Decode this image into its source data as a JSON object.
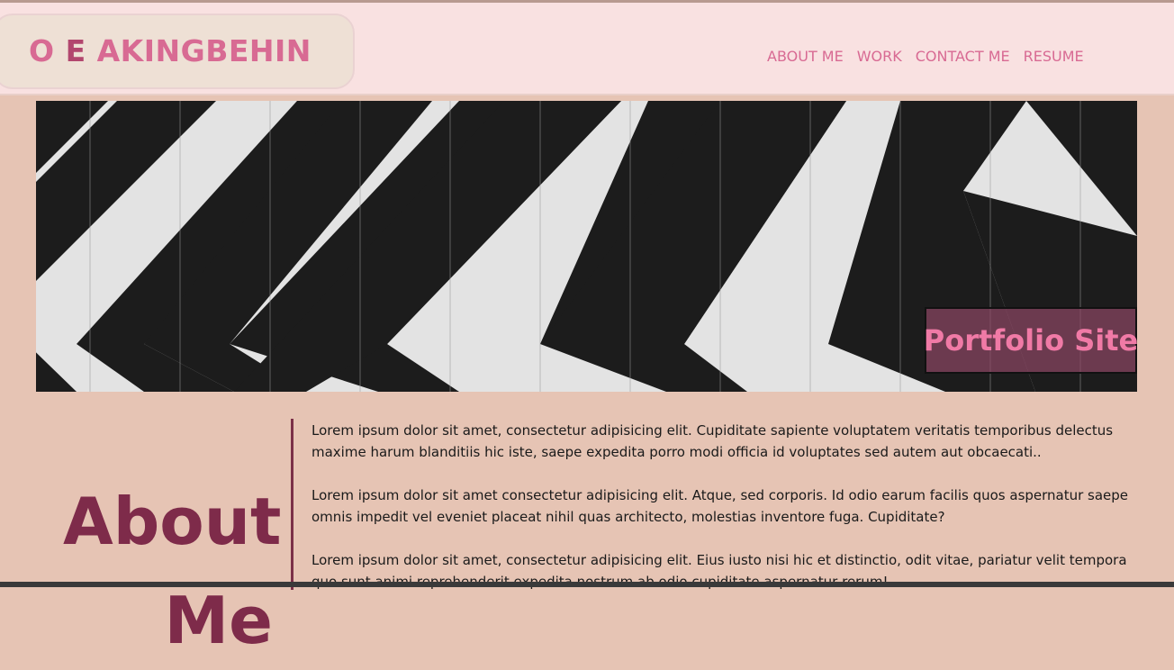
{
  "header": {
    "brand": {
      "part1": "O",
      "part2": "E",
      "part3": "AKINGBEHIN"
    },
    "nav": [
      {
        "label": "ABOUT ME"
      },
      {
        "label": "WORK"
      },
      {
        "label": "CONTACT ME"
      },
      {
        "label": "RESUME"
      }
    ]
  },
  "hero": {
    "image": "black-and-white-striped-wood-image",
    "caption": "Portfolio Site"
  },
  "about": {
    "heading": "About Me",
    "paragraphs": [
      "Lorem ipsum dolor sit amet, consectetur adipisicing elit. Cupiditate sapiente voluptatem veritatis temporibus delectus maxime harum blanditiis hic iste, saepe expedita porro modi officia id voluptates sed autem aut obcaecati..",
      "Lorem ipsum dolor sit amet consectetur adipisicing elit. Atque, sed corporis. Id odio earum facilis quos aspernatur saepe omnis impedit vel eveniet placeat nihil quas architecto, molestias inventore fuga. Cupiditate?",
      "Lorem ipsum dolor sit amet, consectetur adipisicing elit. Eius iusto nisi hic et distinctio, odit vitae, pariatur velit tempora quo sunt animi reprehenderit expedita nostrum ab odio cupiditate aspernatur rerum!"
    ]
  },
  "colors": {
    "page_background": "#e6c4b4",
    "header_background": "#f9e1e1",
    "brand_box": "#eee0d5",
    "accent_pink": "#d86a93",
    "heading_maroon": "#7e2b4a"
  }
}
